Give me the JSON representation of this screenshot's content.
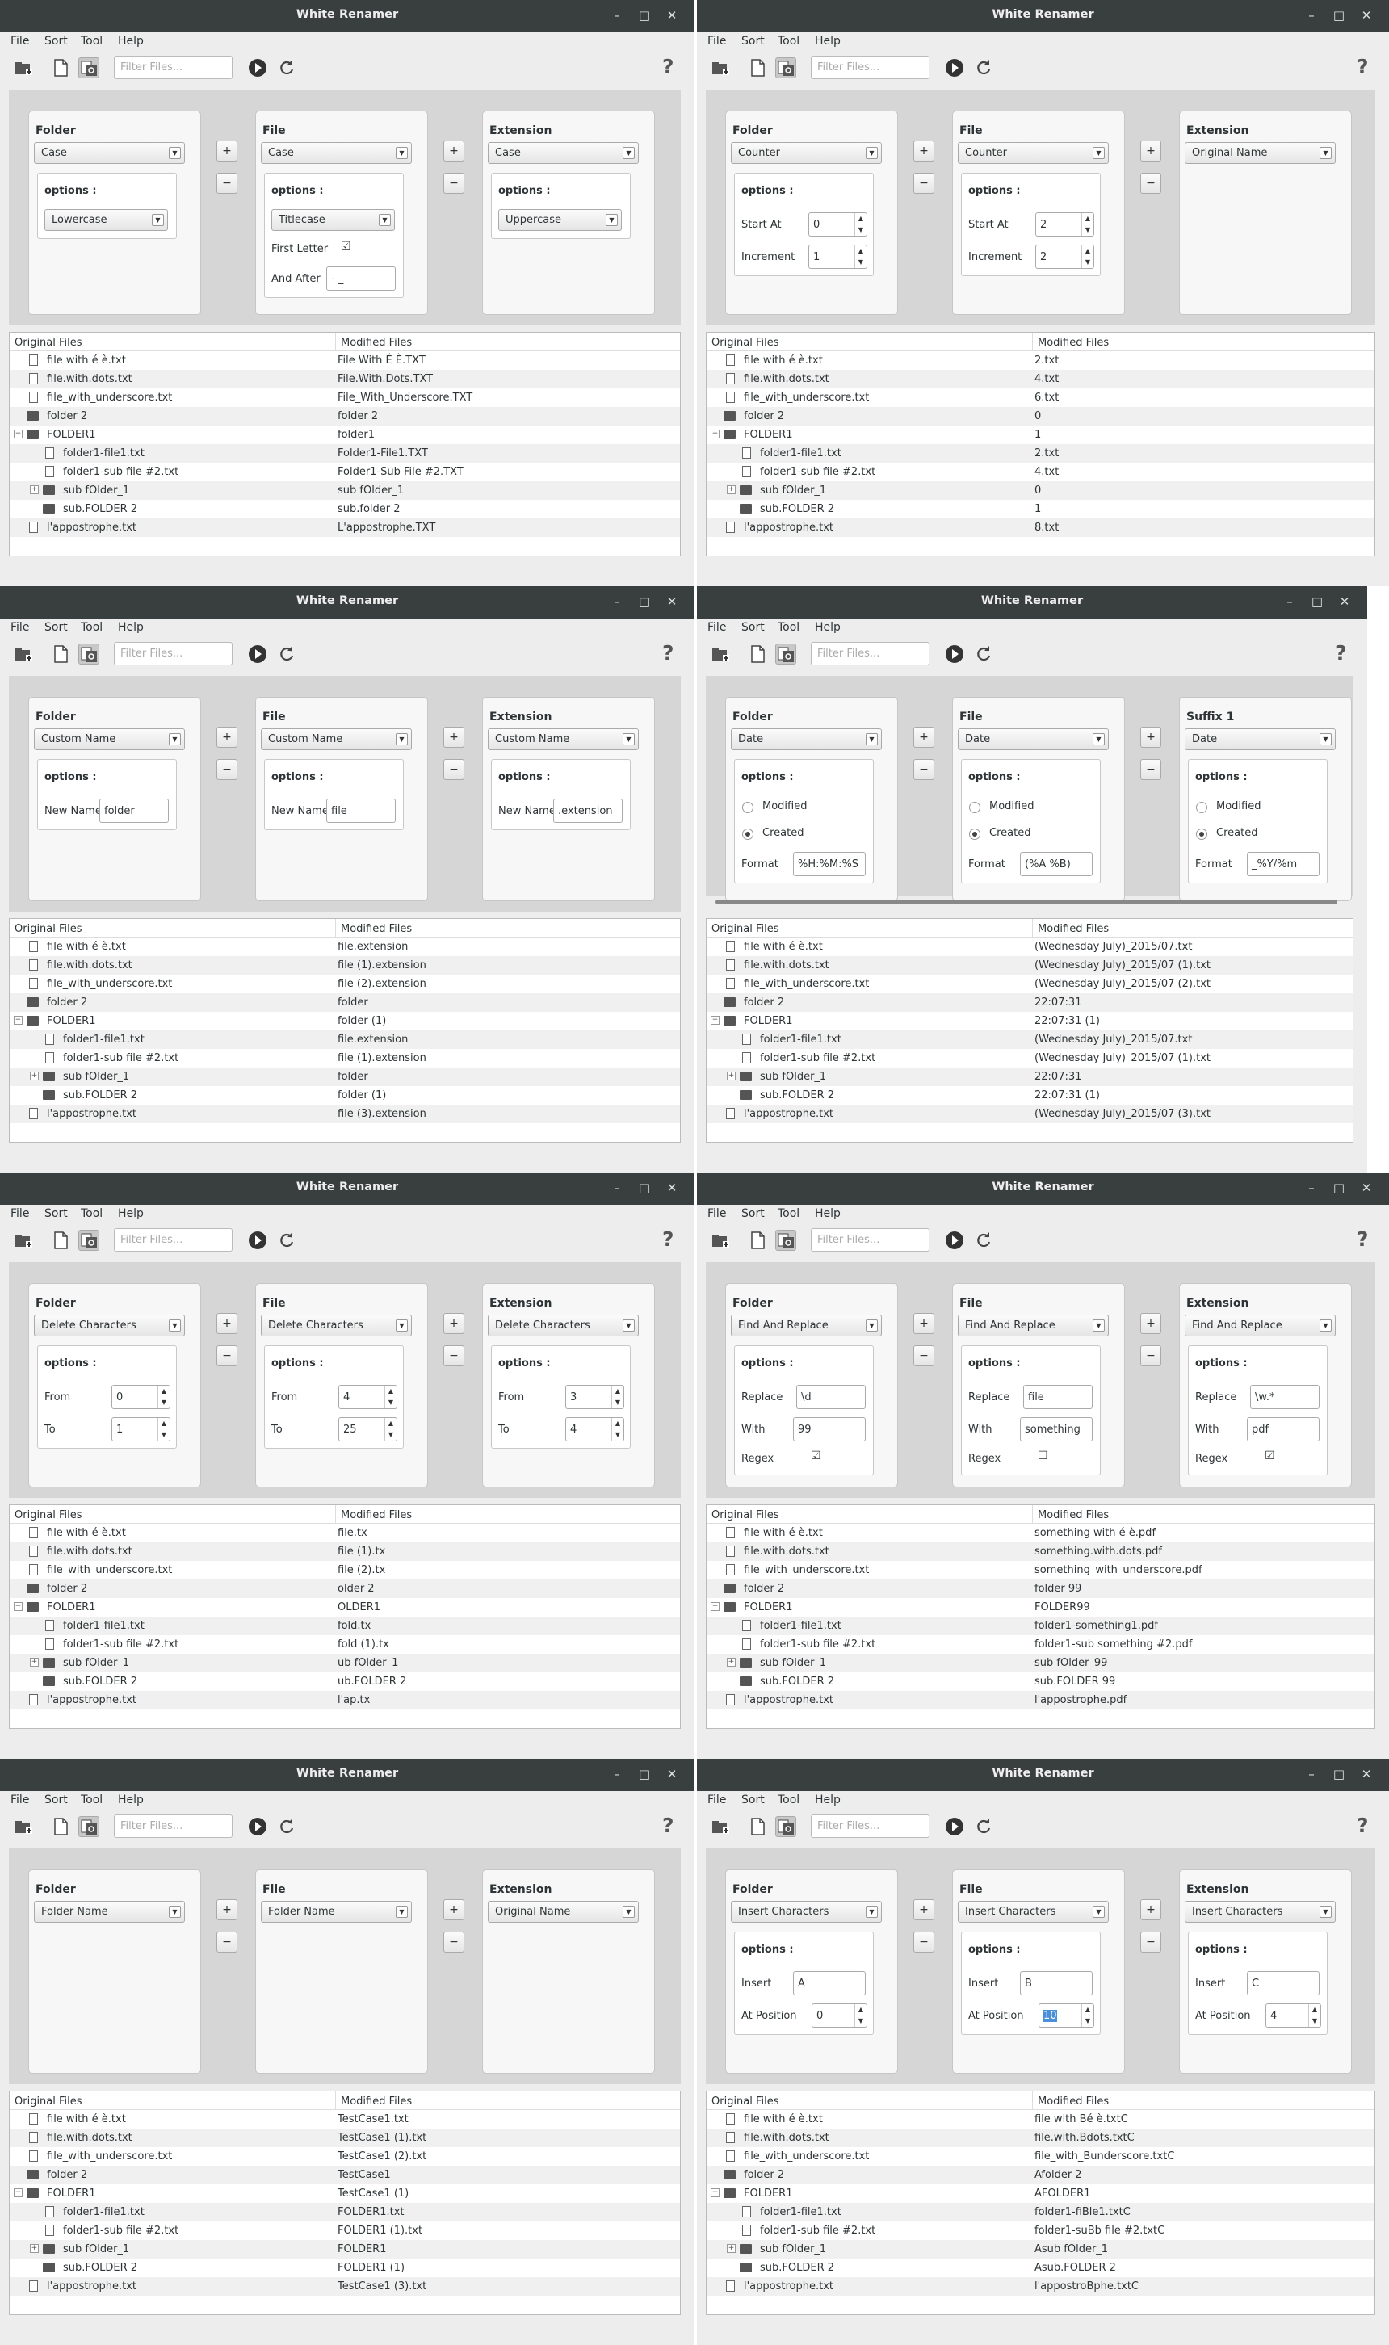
{
  "app": {
    "title": "White Renamer",
    "menu": [
      "File",
      "Sort",
      "Tool",
      "Help"
    ],
    "filter_placeholder": "Filter Files...",
    "help_glyph": "?",
    "window_buttons": [
      "–",
      "□",
      "✕"
    ]
  },
  "table": {
    "col_original": "Original Files",
    "col_modified": "Modified Files",
    "originals": [
      "file with é è.txt",
      "file.with.dots.txt",
      "file_with_underscore.txt",
      "folder 2",
      "FOLDER1",
      "folder1-file1.txt",
      "folder1-sub file #2.txt",
      "sub fOlder_1",
      "sub.FOLDER 2",
      "l'appostrophe.txt"
    ],
    "kinds": [
      "file",
      "file",
      "file",
      "dir",
      "dir",
      "file",
      "file",
      "dir",
      "dir",
      "file"
    ],
    "indent": [
      0,
      0,
      0,
      0,
      0,
      1,
      1,
      1,
      1,
      0
    ],
    "expander": [
      "",
      "",
      "",
      "",
      "−",
      "",
      "",
      "+",
      "",
      ""
    ]
  },
  "windows": [
    {
      "panels": [
        {
          "title": "Folder",
          "select": "Case",
          "options_label": "options :",
          "options": [
            {
              "type": "select",
              "value": "Lowercase"
            }
          ]
        },
        {
          "title": "File",
          "select": "Case",
          "options_label": "options :",
          "options": [
            {
              "type": "select",
              "value": "Titlecase"
            },
            {
              "type": "check",
              "label": "First Letter",
              "checked": true
            },
            {
              "type": "text",
              "label": "And After",
              "value": "- _"
            }
          ]
        },
        {
          "title": "Extension",
          "select": "Case",
          "options_label": "options :",
          "options": [
            {
              "type": "select",
              "value": "Uppercase"
            }
          ]
        }
      ],
      "modified": [
        "File With É È.TXT",
        "File.With.Dots.TXT",
        "File_With_Underscore.TXT",
        "folder 2",
        "folder1",
        "Folder1-File1.TXT",
        "Folder1-Sub File #2.TXT",
        "sub fOlder_1",
        "sub.folder 2",
        "L'appostrophe.TXT"
      ]
    },
    {
      "panels": [
        {
          "title": "Folder",
          "select": "Counter",
          "options_label": "options :",
          "options": [
            {
              "type": "spin",
              "label": "Start At",
              "value": "0"
            },
            {
              "type": "spin",
              "label": "Increment",
              "value": "1"
            }
          ]
        },
        {
          "title": "File",
          "select": "Counter",
          "options_label": "options :",
          "options": [
            {
              "type": "spin",
              "label": "Start At",
              "value": "2"
            },
            {
              "type": "spin",
              "label": "Increment",
              "value": "2"
            }
          ]
        },
        {
          "title": "Extension",
          "select": "Original Name",
          "options_label": "",
          "options": []
        }
      ],
      "modified": [
        "2.txt",
        "4.txt",
        "6.txt",
        "0",
        "1",
        "2.txt",
        "4.txt",
        "0",
        "1",
        "8.txt"
      ]
    },
    {
      "panels": [
        {
          "title": "Folder",
          "select": "Custom Name",
          "options_label": "options :",
          "options": [
            {
              "type": "text",
              "label": "New Name",
              "value": "folder"
            }
          ]
        },
        {
          "title": "File",
          "select": "Custom Name",
          "options_label": "options :",
          "options": [
            {
              "type": "text",
              "label": "New Name",
              "value": "file"
            }
          ]
        },
        {
          "title": "Extension",
          "select": "Custom Name",
          "options_label": "options :",
          "options": [
            {
              "type": "text",
              "label": "New Name",
              "value": ".extension"
            }
          ]
        }
      ],
      "modified": [
        "file.extension",
        "file (1).extension",
        "file (2).extension",
        "folder",
        "folder (1)",
        "file.extension",
        "file (1).extension",
        "folder",
        "folder (1)",
        "file (3).extension"
      ]
    },
    {
      "scroll": true,
      "panels": [
        {
          "title": "Folder",
          "select": "Date",
          "options_label": "options :",
          "options": [
            {
              "type": "radio",
              "label": "Modified",
              "on": false
            },
            {
              "type": "radio",
              "label": "Created",
              "on": true
            },
            {
              "type": "text",
              "label": "Format",
              "value": "%H:%M:%S"
            }
          ]
        },
        {
          "title": "File",
          "select": "Date",
          "options_label": "options :",
          "options": [
            {
              "type": "radio",
              "label": "Modified",
              "on": false
            },
            {
              "type": "radio",
              "label": "Created",
              "on": true
            },
            {
              "type": "text",
              "label": "Format",
              "value": "(%A %B)"
            }
          ]
        },
        {
          "title": "Suffix 1",
          "select": "Date",
          "options_label": "options :",
          "options": [
            {
              "type": "radio",
              "label": "Modified",
              "on": false
            },
            {
              "type": "radio",
              "label": "Created",
              "on": true
            },
            {
              "type": "text",
              "label": "Format",
              "value": "_%Y/%m"
            }
          ]
        }
      ],
      "modified": [
        "(Wednesday July)_2015/07.txt",
        "(Wednesday July)_2015/07 (1).txt",
        "(Wednesday July)_2015/07 (2).txt",
        "22:07:31",
        "22:07:31 (1)",
        "(Wednesday July)_2015/07.txt",
        "(Wednesday July)_2015/07 (1).txt",
        "22:07:31",
        "22:07:31 (1)",
        "(Wednesday July)_2015/07 (3).txt"
      ]
    },
    {
      "panels": [
        {
          "title": "Folder",
          "select": "Delete Characters",
          "options_label": "options :",
          "options": [
            {
              "type": "spin",
              "label": "From",
              "value": "0"
            },
            {
              "type": "spin",
              "label": "To",
              "value": "1"
            }
          ]
        },
        {
          "title": "File",
          "select": "Delete Characters",
          "options_label": "options :",
          "options": [
            {
              "type": "spin",
              "label": "From",
              "value": "4"
            },
            {
              "type": "spin",
              "label": "To",
              "value": "25"
            }
          ]
        },
        {
          "title": "Extension",
          "select": "Delete Characters",
          "options_label": "options :",
          "options": [
            {
              "type": "spin",
              "label": "From",
              "value": "3"
            },
            {
              "type": "spin",
              "label": "To",
              "value": "4"
            }
          ]
        }
      ],
      "modified": [
        "file.tx",
        "file (1).tx",
        "file (2).tx",
        "older 2",
        "OLDER1",
        "fold.tx",
        "fold (1).tx",
        "ub fOlder_1",
        "ub.FOLDER 2",
        "l'ap.tx"
      ]
    },
    {
      "panels": [
        {
          "title": "Folder",
          "select": "Find And Replace",
          "options_label": "options :",
          "options": [
            {
              "type": "text",
              "label": "Replace",
              "value": "\\d"
            },
            {
              "type": "text",
              "label": "With",
              "value": "99"
            },
            {
              "type": "check",
              "label": "Regex",
              "checked": true
            }
          ]
        },
        {
          "title": "File",
          "select": "Find And Replace",
          "options_label": "options :",
          "options": [
            {
              "type": "text",
              "label": "Replace",
              "value": "file"
            },
            {
              "type": "text",
              "label": "With",
              "value": "something"
            },
            {
              "type": "check",
              "label": "Regex",
              "checked": false
            }
          ]
        },
        {
          "title": "Extension",
          "select": "Find And Replace",
          "options_label": "options :",
          "options": [
            {
              "type": "text",
              "label": "Replace",
              "value": "\\w.*"
            },
            {
              "type": "text",
              "label": "With",
              "value": "pdf"
            },
            {
              "type": "check",
              "label": "Regex",
              "checked": true
            }
          ]
        }
      ],
      "modified": [
        "something with é è.pdf",
        "something.with.dots.pdf",
        "something_with_underscore.pdf",
        "folder 99",
        "FOLDER99",
        "folder1-something1.pdf",
        "folder1-sub something #2.pdf",
        "sub fOlder_99",
        "sub.FOLDER 99",
        "l'appostrophe.pdf"
      ]
    },
    {
      "panels": [
        {
          "title": "Folder",
          "select": "Folder Name",
          "options_label": "",
          "options": []
        },
        {
          "title": "File",
          "select": "Folder Name",
          "options_label": "",
          "options": []
        },
        {
          "title": "Extension",
          "select": "Original Name",
          "options_label": "",
          "options": []
        }
      ],
      "modified": [
        "TestCase1.txt",
        "TestCase1 (1).txt",
        "TestCase1 (2).txt",
        "TestCase1",
        "TestCase1 (1)",
        "FOLDER1.txt",
        "FOLDER1 (1).txt",
        "FOLDER1",
        "FOLDER1 (1)",
        "TestCase1 (3).txt"
      ]
    },
    {
      "panels": [
        {
          "title": "Folder",
          "select": "Insert Characters",
          "options_label": "options :",
          "options": [
            {
              "type": "text",
              "label": "Insert",
              "value": "A"
            },
            {
              "type": "spin",
              "label": "At Position",
              "value": "0"
            }
          ]
        },
        {
          "title": "File",
          "select": "Insert Characters",
          "options_label": "options :",
          "options": [
            {
              "type": "text",
              "label": "Insert",
              "value": "B"
            },
            {
              "type": "spin",
              "label": "At Position",
              "value": "10",
              "selected": true
            }
          ]
        },
        {
          "title": "Extension",
          "select": "Insert Characters",
          "options_label": "options :",
          "options": [
            {
              "type": "text",
              "label": "Insert",
              "value": "C"
            },
            {
              "type": "spin",
              "label": "At Position",
              "value": "4"
            }
          ]
        }
      ],
      "modified": [
        "file with Bé è.txtC",
        "file.with.Bdots.txtC",
        "file_with_Bunderscore.txtC",
        "Afolder 2",
        "AFOLDER1",
        "folder1-fiBle1.txtC",
        "folder1-suBb file #2.txtC",
        "Asub fOlder_1",
        "Asub.FOLDER 2",
        "l'appostroBphe.txtC"
      ]
    }
  ]
}
